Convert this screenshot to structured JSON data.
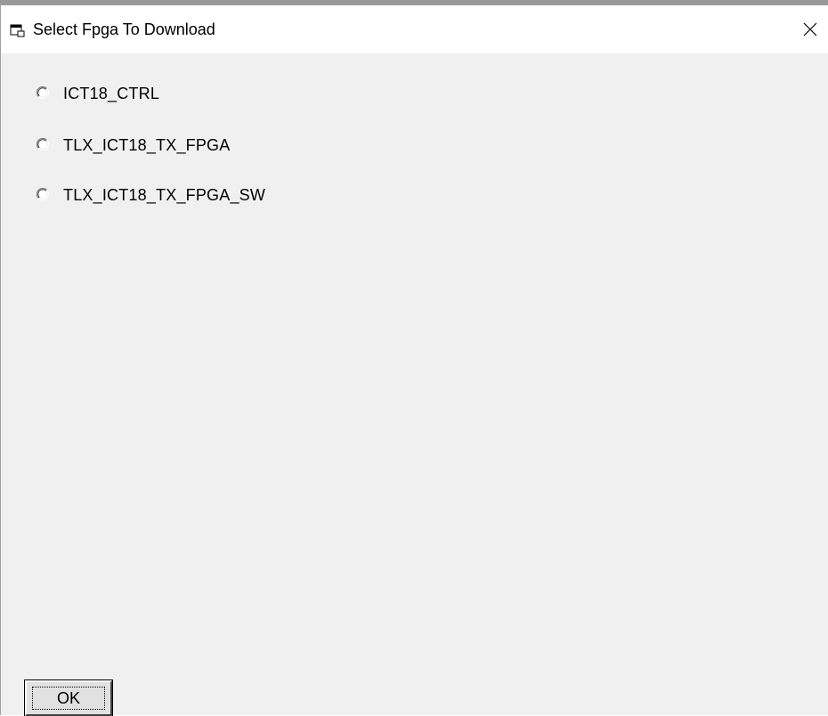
{
  "window": {
    "title": "Select Fpga To Download",
    "close_symbol": "✕"
  },
  "options": [
    {
      "label": "ICT18_CTRL",
      "selected": false
    },
    {
      "label": "TLX_ICT18_TX_FPGA",
      "selected": false
    },
    {
      "label": "TLX_ICT18_TX_FPGA_SW",
      "selected": false
    }
  ],
  "buttons": {
    "ok_label": "OK"
  },
  "colors": {
    "titlebar_bg": "#ffffff",
    "client_bg": "#f0f0f0",
    "button_face": "#e1e1e1"
  },
  "icons": {
    "app": "window-app-icon",
    "close": "close-icon",
    "radio": "radio-unchecked-icon"
  }
}
